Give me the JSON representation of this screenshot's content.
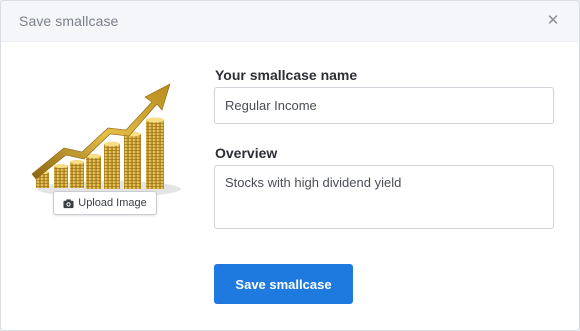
{
  "modal": {
    "title": "Save smallcase",
    "close_icon": "close-icon"
  },
  "image": {
    "description_icon": "growth-chart-coins-image",
    "upload_label": "Upload Image",
    "upload_icon": "camera-icon"
  },
  "form": {
    "name_label": "Your smallcase name",
    "name_value": "Regular Income",
    "overview_label": "Overview",
    "overview_value": "Stocks with high dividend yield"
  },
  "actions": {
    "save_label": "Save smallcase",
    "save_color": "#1f7ae0"
  },
  "colors": {
    "header_bg": "#f5f6f9",
    "arrow_gold": "#c99a1e"
  }
}
